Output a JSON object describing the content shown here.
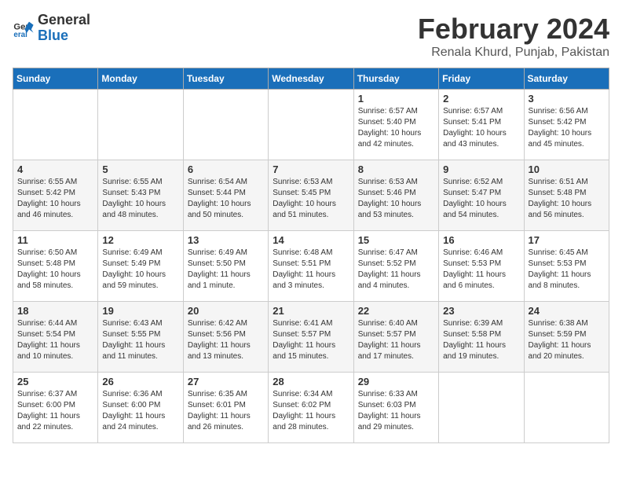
{
  "header": {
    "logo_line1": "General",
    "logo_line2": "Blue",
    "month": "February 2024",
    "location": "Renala Khurd, Punjab, Pakistan"
  },
  "weekdays": [
    "Sunday",
    "Monday",
    "Tuesday",
    "Wednesday",
    "Thursday",
    "Friday",
    "Saturday"
  ],
  "weeks": [
    [
      {
        "day": "",
        "info": ""
      },
      {
        "day": "",
        "info": ""
      },
      {
        "day": "",
        "info": ""
      },
      {
        "day": "",
        "info": ""
      },
      {
        "day": "1",
        "info": "Sunrise: 6:57 AM\nSunset: 5:40 PM\nDaylight: 10 hours\nand 42 minutes."
      },
      {
        "day": "2",
        "info": "Sunrise: 6:57 AM\nSunset: 5:41 PM\nDaylight: 10 hours\nand 43 minutes."
      },
      {
        "day": "3",
        "info": "Sunrise: 6:56 AM\nSunset: 5:42 PM\nDaylight: 10 hours\nand 45 minutes."
      }
    ],
    [
      {
        "day": "4",
        "info": "Sunrise: 6:55 AM\nSunset: 5:42 PM\nDaylight: 10 hours\nand 46 minutes."
      },
      {
        "day": "5",
        "info": "Sunrise: 6:55 AM\nSunset: 5:43 PM\nDaylight: 10 hours\nand 48 minutes."
      },
      {
        "day": "6",
        "info": "Sunrise: 6:54 AM\nSunset: 5:44 PM\nDaylight: 10 hours\nand 50 minutes."
      },
      {
        "day": "7",
        "info": "Sunrise: 6:53 AM\nSunset: 5:45 PM\nDaylight: 10 hours\nand 51 minutes."
      },
      {
        "day": "8",
        "info": "Sunrise: 6:53 AM\nSunset: 5:46 PM\nDaylight: 10 hours\nand 53 minutes."
      },
      {
        "day": "9",
        "info": "Sunrise: 6:52 AM\nSunset: 5:47 PM\nDaylight: 10 hours\nand 54 minutes."
      },
      {
        "day": "10",
        "info": "Sunrise: 6:51 AM\nSunset: 5:48 PM\nDaylight: 10 hours\nand 56 minutes."
      }
    ],
    [
      {
        "day": "11",
        "info": "Sunrise: 6:50 AM\nSunset: 5:48 PM\nDaylight: 10 hours\nand 58 minutes."
      },
      {
        "day": "12",
        "info": "Sunrise: 6:49 AM\nSunset: 5:49 PM\nDaylight: 10 hours\nand 59 minutes."
      },
      {
        "day": "13",
        "info": "Sunrise: 6:49 AM\nSunset: 5:50 PM\nDaylight: 11 hours\nand 1 minute."
      },
      {
        "day": "14",
        "info": "Sunrise: 6:48 AM\nSunset: 5:51 PM\nDaylight: 11 hours\nand 3 minutes."
      },
      {
        "day": "15",
        "info": "Sunrise: 6:47 AM\nSunset: 5:52 PM\nDaylight: 11 hours\nand 4 minutes."
      },
      {
        "day": "16",
        "info": "Sunrise: 6:46 AM\nSunset: 5:53 PM\nDaylight: 11 hours\nand 6 minutes."
      },
      {
        "day": "17",
        "info": "Sunrise: 6:45 AM\nSunset: 5:53 PM\nDaylight: 11 hours\nand 8 minutes."
      }
    ],
    [
      {
        "day": "18",
        "info": "Sunrise: 6:44 AM\nSunset: 5:54 PM\nDaylight: 11 hours\nand 10 minutes."
      },
      {
        "day": "19",
        "info": "Sunrise: 6:43 AM\nSunset: 5:55 PM\nDaylight: 11 hours\nand 11 minutes."
      },
      {
        "day": "20",
        "info": "Sunrise: 6:42 AM\nSunset: 5:56 PM\nDaylight: 11 hours\nand 13 minutes."
      },
      {
        "day": "21",
        "info": "Sunrise: 6:41 AM\nSunset: 5:57 PM\nDaylight: 11 hours\nand 15 minutes."
      },
      {
        "day": "22",
        "info": "Sunrise: 6:40 AM\nSunset: 5:57 PM\nDaylight: 11 hours\nand 17 minutes."
      },
      {
        "day": "23",
        "info": "Sunrise: 6:39 AM\nSunset: 5:58 PM\nDaylight: 11 hours\nand 19 minutes."
      },
      {
        "day": "24",
        "info": "Sunrise: 6:38 AM\nSunset: 5:59 PM\nDaylight: 11 hours\nand 20 minutes."
      }
    ],
    [
      {
        "day": "25",
        "info": "Sunrise: 6:37 AM\nSunset: 6:00 PM\nDaylight: 11 hours\nand 22 minutes."
      },
      {
        "day": "26",
        "info": "Sunrise: 6:36 AM\nSunset: 6:00 PM\nDaylight: 11 hours\nand 24 minutes."
      },
      {
        "day": "27",
        "info": "Sunrise: 6:35 AM\nSunset: 6:01 PM\nDaylight: 11 hours\nand 26 minutes."
      },
      {
        "day": "28",
        "info": "Sunrise: 6:34 AM\nSunset: 6:02 PM\nDaylight: 11 hours\nand 28 minutes."
      },
      {
        "day": "29",
        "info": "Sunrise: 6:33 AM\nSunset: 6:03 PM\nDaylight: 11 hours\nand 29 minutes."
      },
      {
        "day": "",
        "info": ""
      },
      {
        "day": "",
        "info": ""
      }
    ]
  ]
}
